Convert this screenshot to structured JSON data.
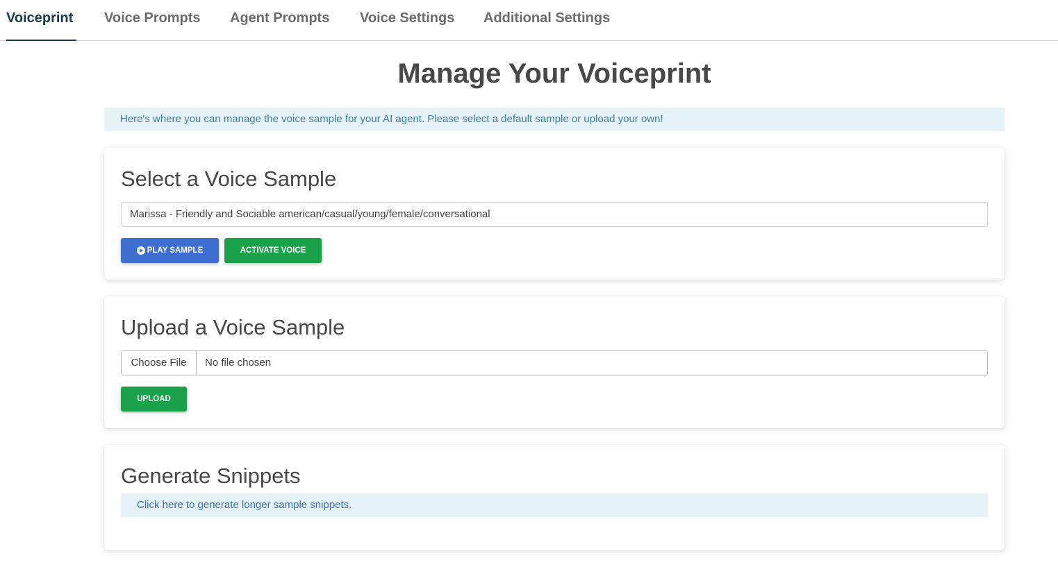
{
  "tabs": [
    {
      "label": "Voiceprint",
      "active": true
    },
    {
      "label": "Voice Prompts",
      "active": false
    },
    {
      "label": "Agent Prompts",
      "active": false
    },
    {
      "label": "Voice Settings",
      "active": false
    },
    {
      "label": "Additional Settings",
      "active": false
    }
  ],
  "page": {
    "title": "Manage Your Voiceprint",
    "info": "Here's where you can manage the voice sample for your AI agent. Please select a default sample or upload your own!"
  },
  "select_card": {
    "title": "Select a Voice Sample",
    "selected_voice": "Marissa - Friendly and Sociable american/casual/young/female/conversational",
    "play_label": "Play Sample",
    "activate_label": "Activate Voice"
  },
  "upload_card": {
    "title": "Upload a Voice Sample",
    "choose_label": "Choose File",
    "file_status": "No file chosen",
    "upload_label": "Upload"
  },
  "snippets_card": {
    "title": "Generate Snippets",
    "link_text": "Click here to generate longer sample snippets."
  },
  "colors": {
    "accent_dark": "#143b47",
    "primary_blue": "#3e6ed0",
    "success_green": "#1aa24a",
    "info_bg": "#e5f3f9"
  }
}
